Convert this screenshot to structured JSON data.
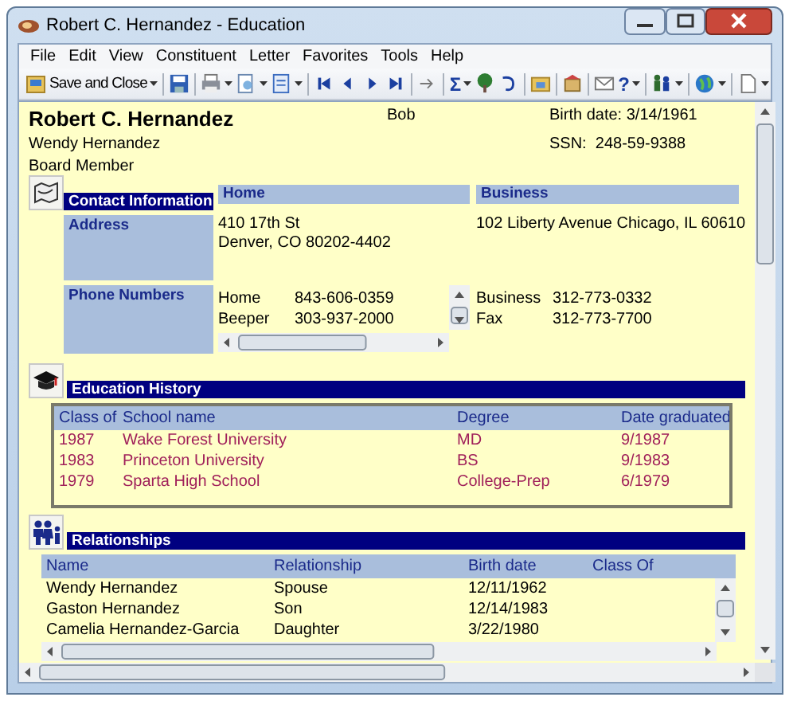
{
  "window": {
    "title": "Robert C. Hernandez - Education"
  },
  "menu": [
    "File",
    "Edit",
    "View",
    "Constituent",
    "Letter",
    "Favorites",
    "Tools",
    "Help"
  ],
  "toolbar": [
    {
      "kind": "text",
      "label": "Save and Close",
      "dropdown": true
    },
    {
      "kind": "separator"
    },
    {
      "kind": "icon",
      "dropdown": false
    },
    {
      "kind": "separator"
    },
    {
      "kind": "icon",
      "dropdown": true
    },
    {
      "kind": "icon",
      "dropdown": true
    },
    {
      "kind": "icon",
      "dropdown": true
    },
    {
      "kind": "separator"
    },
    {
      "kind": "icon",
      "dropdown": false
    },
    {
      "kind": "icon",
      "dropdown": false
    },
    {
      "kind": "icon",
      "dropdown": false
    },
    {
      "kind": "icon",
      "dropdown": false
    },
    {
      "kind": "separator"
    },
    {
      "kind": "icon",
      "dropdown": false
    },
    {
      "kind": "separator"
    },
    {
      "kind": "glyph",
      "text": "Σ",
      "dropdown": true
    },
    {
      "kind": "icon",
      "dropdown": false
    },
    {
      "kind": "icon",
      "dropdown": false
    },
    {
      "kind": "separator"
    },
    {
      "kind": "icon",
      "dropdown": false
    },
    {
      "kind": "separator"
    },
    {
      "kind": "icon",
      "dropdown": false
    },
    {
      "kind": "separator"
    },
    {
      "kind": "icon",
      "dropdown": false
    },
    {
      "kind": "glyph",
      "text": "?",
      "dropdown": true
    },
    {
      "kind": "separator"
    },
    {
      "kind": "icon",
      "dropdown": true
    },
    {
      "kind": "separator"
    },
    {
      "kind": "icon",
      "dropdown": true
    },
    {
      "kind": "separator"
    },
    {
      "kind": "icon",
      "dropdown": true
    }
  ],
  "record": {
    "name": "Robert C. Hernandez",
    "nickname": "Bob",
    "spouse": "Wendy Hernandez",
    "title": "Board Member",
    "birth_date_label": "Birth date:",
    "birth_date": "3/14/1961",
    "ssn_label": "SSN:",
    "ssn": "248-59-9388"
  },
  "contact": {
    "title": "Contact Information",
    "columns": [
      "Home",
      "Business"
    ],
    "address": {
      "label": "Address",
      "home": [
        "410 17th St",
        "Denver, CO 80202-4402"
      ],
      "business": [
        "102 Liberty Avenue Chicago, IL 60610"
      ]
    },
    "phones": {
      "label": "Phone Numbers",
      "home": [
        {
          "type": "Home",
          "number": "843-606-0359"
        },
        {
          "type": "Beeper",
          "number": "303-937-2000"
        }
      ],
      "business": [
        {
          "type": "Business",
          "number": "312-773-0332"
        },
        {
          "type": "Fax",
          "number": "312-773-7700"
        }
      ]
    }
  },
  "education": {
    "title": "Education History",
    "columns": [
      "Class of",
      "School name",
      "Degree",
      "Date graduated"
    ],
    "rows": [
      [
        "1987",
        "Wake Forest University",
        "MD",
        "9/1987"
      ],
      [
        "1983",
        "Princeton University",
        "BS",
        "9/1983"
      ],
      [
        "1979",
        "Sparta High School",
        "College-Prep",
        "6/1979"
      ]
    ]
  },
  "relationships": {
    "title": "Relationships",
    "columns": [
      "Name",
      "Relationship",
      "Birth date",
      "Class Of"
    ],
    "rows": [
      [
        "Wendy Hernandez",
        "Spouse",
        "12/11/1962",
        ""
      ],
      [
        "Gaston Hernandez",
        "Son",
        "12/14/1983",
        ""
      ],
      [
        "Camelia Hernandez-Garcia",
        "Daughter",
        "3/22/1980",
        ""
      ]
    ]
  }
}
